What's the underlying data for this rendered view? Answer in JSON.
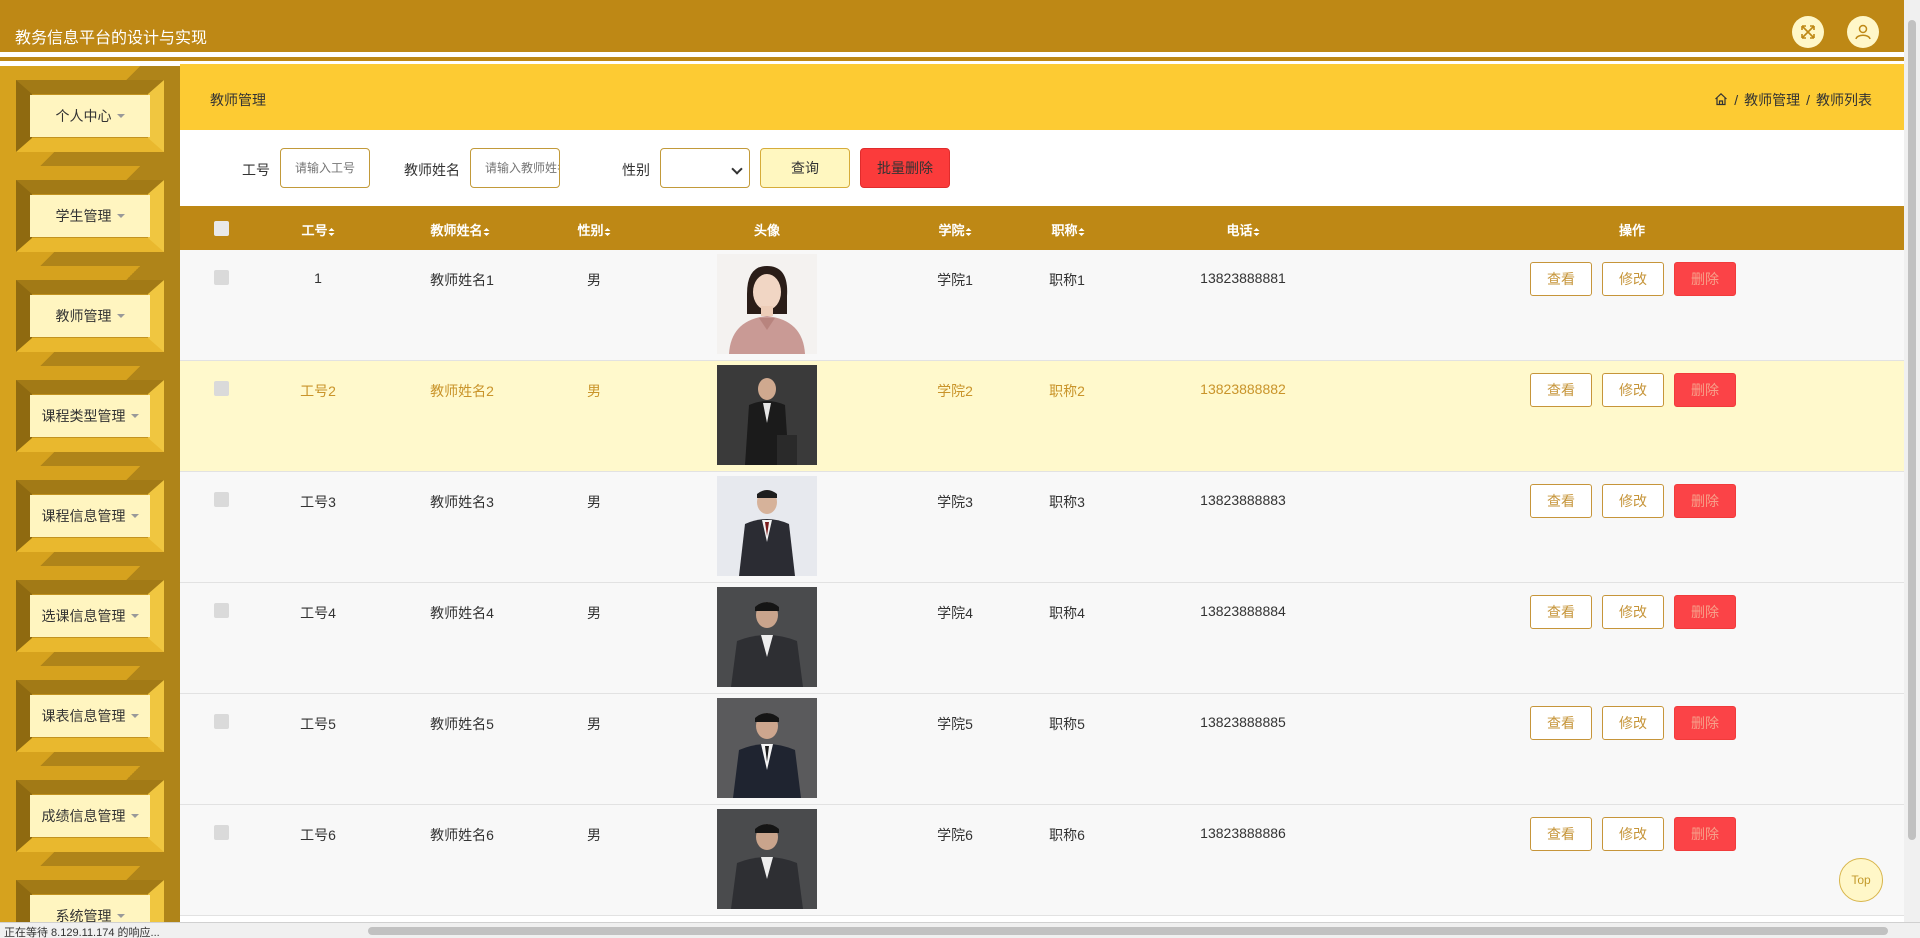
{
  "header": {
    "title": "教务信息平台的设计与实现",
    "fullscreen_icon": "expand-icon",
    "user_icon": "user-icon"
  },
  "sidebar": {
    "items": [
      {
        "label": "个人中心"
      },
      {
        "label": "学生管理"
      },
      {
        "label": "教师管理"
      },
      {
        "label": "课程类型管理"
      },
      {
        "label": "课程信息管理"
      },
      {
        "label": "选课信息管理"
      },
      {
        "label": "课表信息管理"
      },
      {
        "label": "成绩信息管理"
      },
      {
        "label": "系统管理"
      }
    ]
  },
  "breadcrumb": {
    "page_title": "教师管理",
    "home_icon": "home-icon",
    "items": [
      "教师管理",
      "教师列表"
    ],
    "separator": "/"
  },
  "search": {
    "gonghao_label": "工号",
    "gonghao_placeholder": "请输入工号",
    "name_label": "教师姓名",
    "name_placeholder": "请输入教师姓名",
    "gender_label": "性别",
    "gender_value": "",
    "query_button": "查询",
    "batch_delete_button": "批量删除"
  },
  "table": {
    "columns": [
      "工号",
      "教师姓名",
      "性别",
      "头像",
      "学院",
      "职称",
      "电话",
      "操作"
    ],
    "rows": [
      {
        "gonghao": "1",
        "name": "教师姓名1",
        "gender": "男",
        "college": "学院1",
        "title": "职称1",
        "phone": "13823888881"
      },
      {
        "gonghao": "工号2",
        "name": "教师姓名2",
        "gender": "男",
        "college": "学院2",
        "title": "职称2",
        "phone": "13823888882"
      },
      {
        "gonghao": "工号3",
        "name": "教师姓名3",
        "gender": "男",
        "college": "学院3",
        "title": "职称3",
        "phone": "13823888883"
      },
      {
        "gonghao": "工号4",
        "name": "教师姓名4",
        "gender": "男",
        "college": "学院4",
        "title": "职称4",
        "phone": "13823888884"
      },
      {
        "gonghao": "工号5",
        "name": "教师姓名5",
        "gender": "男",
        "college": "学院5",
        "title": "职称5",
        "phone": "13823888885"
      },
      {
        "gonghao": "工号6",
        "name": "教师姓名6",
        "gender": "男",
        "college": "学院6",
        "title": "职称6",
        "phone": "13823888886"
      }
    ],
    "actions": {
      "view": "查看",
      "edit": "修改",
      "delete": "删除"
    }
  },
  "top_button": "Top",
  "status_bar": {
    "text": "正在等待 8.129.11.174 的响应..."
  },
  "colors": {
    "header": "#BE8815",
    "crumb_bar": "#FDCB33",
    "sidebar": "#F2C03A",
    "danger": "#FB3B3B",
    "highlight_row": "#FFF9CC"
  }
}
